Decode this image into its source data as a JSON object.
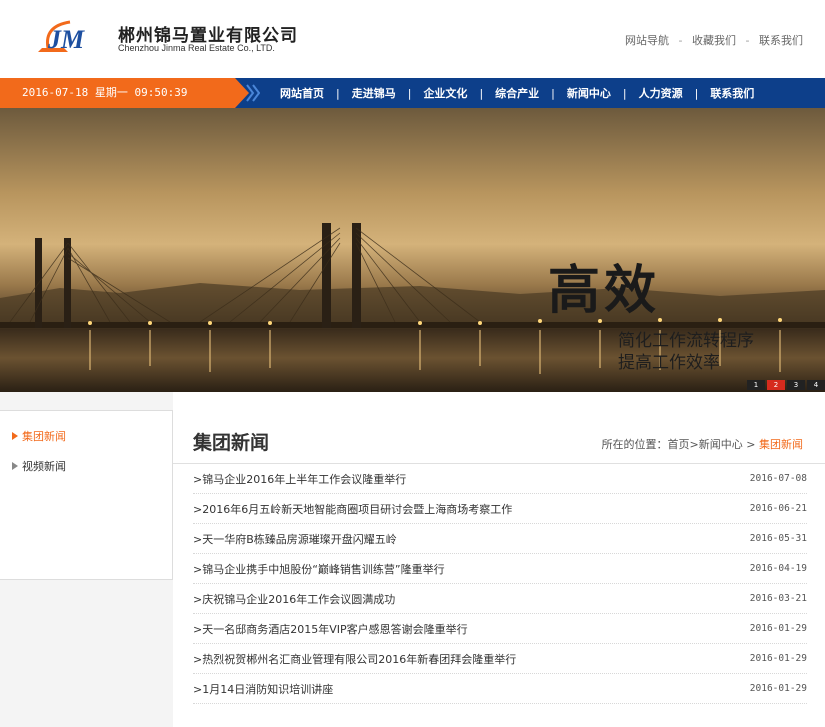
{
  "header": {
    "logo_cn": "郴州锦马置业有限公司",
    "logo_en": "Chenzhou Jinma Real Estate Co., LTD.",
    "top_links": [
      "网站导航",
      "收藏我们",
      "联系我们"
    ],
    "sep": "-"
  },
  "navbar": {
    "date": "2016-07-18 星期一 09:50:39",
    "items": [
      "网站首页",
      "走进锦马",
      "企业文化",
      "综合产业",
      "新闻中心",
      "人力资源",
      "联系我们"
    ],
    "sep": "|"
  },
  "banner": {
    "title": "高效",
    "line1": "简化工作流转程序",
    "line2": "提高工作效率",
    "dots": [
      "1",
      "2",
      "3",
      "4"
    ],
    "active_dot": 2
  },
  "sidebar": {
    "items": [
      {
        "label": "集团新闻",
        "active": true
      },
      {
        "label": "视频新闻",
        "active": false
      }
    ]
  },
  "main": {
    "title": "集团新闻",
    "breadcrumb_prefix": "所在的位置：首页>新闻中心 > ",
    "breadcrumb_current": "集团新闻",
    "news": [
      {
        "title": ">锦马企业2016年上半年工作会议隆重举行",
        "date": "2016-07-08"
      },
      {
        "title": ">2016年6月五岭新天地智能商圈项目研讨会暨上海商场考察工作",
        "date": "2016-06-21"
      },
      {
        "title": ">天一华府B栋臻品房源璀璨开盘闪耀五岭",
        "date": "2016-05-31"
      },
      {
        "title": ">锦马企业携手中旭股份“巅峰销售训练营”隆重举行",
        "date": "2016-04-19"
      },
      {
        "title": ">庆祝锦马企业2016年工作会议圆满成功",
        "date": "2016-03-21"
      },
      {
        "title": ">天一名邸商务酒店2015年VIP客户感恩答谢会隆重举行",
        "date": "2016-01-29"
      },
      {
        "title": ">热烈祝贺郴州名汇商业管理有限公司2016年新春团拜会隆重举行",
        "date": "2016-01-29"
      },
      {
        "title": ">1月14日消防知识培训讲座",
        "date": "2016-01-29"
      }
    ]
  },
  "colors": {
    "accent": "#f26a1b",
    "nav": "#0d3f8a",
    "active_dot": "#d62b1e"
  }
}
